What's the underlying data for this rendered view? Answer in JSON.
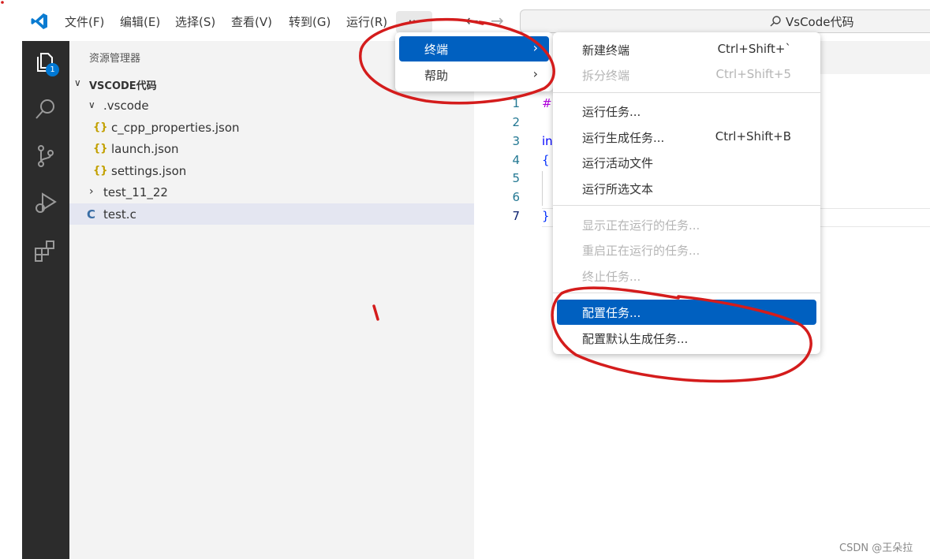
{
  "titlebar": {
    "menu": [
      "文件(F)",
      "编辑(E)",
      "选择(S)",
      "查看(V)",
      "转到(G)",
      "运行(R)"
    ],
    "more": "···",
    "search_text": "VsCode代码"
  },
  "activity": {
    "explorer_badge": "1"
  },
  "sidebar": {
    "title": "资源管理器",
    "root": "VSCODE代码",
    "items": [
      {
        "label": ".vscode",
        "icon": "chevron-down-icon"
      },
      {
        "label": "c_cpp_properties.json",
        "icon": "json-icon",
        "glyph": "{}"
      },
      {
        "label": "launch.json",
        "icon": "json-icon",
        "glyph": "{}"
      },
      {
        "label": "settings.json",
        "icon": "json-icon",
        "glyph": "{}"
      },
      {
        "label": "test_11_22",
        "icon": "chevron-right-icon"
      },
      {
        "label": "test.c",
        "icon": "c-file-icon",
        "glyph": "C"
      }
    ]
  },
  "editor": {
    "line_numbers": [
      "1",
      "2",
      "3",
      "4",
      "5",
      "6",
      "7"
    ],
    "code": [
      "#i",
      "",
      "in",
      "{",
      "",
      "",
      "}"
    ]
  },
  "menu1": {
    "items": [
      {
        "label": "终端",
        "highlighted": true
      },
      {
        "label": "帮助",
        "highlighted": false
      }
    ]
  },
  "menu2": {
    "items": [
      {
        "label": "新建终端",
        "key": "Ctrl+Shift+`",
        "enabled": true
      },
      {
        "label": "拆分终端",
        "key": "Ctrl+Shift+5",
        "enabled": false
      },
      {
        "label": "运行任务...",
        "key": "",
        "enabled": true
      },
      {
        "label": "运行生成任务...",
        "key": "Ctrl+Shift+B",
        "enabled": true
      },
      {
        "label": "运行活动文件",
        "key": "",
        "enabled": true
      },
      {
        "label": "运行所选文本",
        "key": "",
        "enabled": true
      },
      {
        "label": "显示正在运行的任务...",
        "key": "",
        "enabled": false
      },
      {
        "label": "重启正在运行的任务...",
        "key": "",
        "enabled": false
      },
      {
        "label": "终止任务...",
        "key": "",
        "enabled": false
      },
      {
        "label": "配置任务...",
        "key": "",
        "enabled": true,
        "highlighted": true
      },
      {
        "label": "配置默认生成任务...",
        "key": "",
        "enabled": true
      }
    ]
  },
  "watermark": "CSDN @王朵拉",
  "colors": {
    "accent": "#0060c0",
    "activity_bar": "#2c2c2c",
    "annotation": "#d41c1c"
  }
}
